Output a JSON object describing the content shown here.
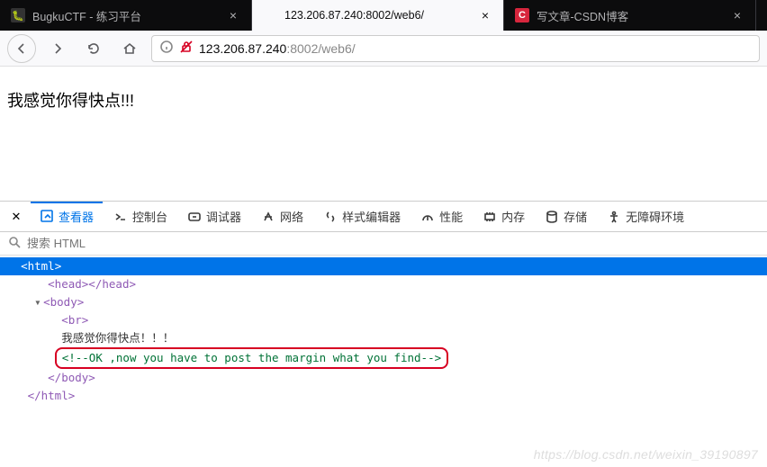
{
  "tabs": [
    {
      "title": "BugkuCTF - 练习平台",
      "favicon": "bug"
    },
    {
      "title": "123.206.87.240:8002/web6/",
      "favicon": "",
      "active": true
    },
    {
      "title": "写文章-CSDN博客",
      "favicon": "C"
    }
  ],
  "url": {
    "host": "123.206.87.240",
    "port": ":8002",
    "path": "/web6/"
  },
  "page_text": "我感觉你得快点!!!",
  "devtools": {
    "tabs": {
      "inspector": "查看器",
      "console": "控制台",
      "debugger": "调试器",
      "network": "网络",
      "style": "样式编辑器",
      "performance": "性能",
      "memory": "内存",
      "storage": "存储",
      "a11y": "无障碍环境"
    },
    "search_placeholder": "搜索 HTML",
    "dom": {
      "html_open": "<html>",
      "head": "<head></head>",
      "body_open": "<body>",
      "br": "<br>",
      "text": "我感觉你得快点！！！",
      "comment": "<!--OK ,now you have to post the margin what you find-->",
      "body_close": "</body>",
      "html_close": "</html>"
    }
  },
  "watermark": "https://blog.csdn.net/weixin_39190897"
}
